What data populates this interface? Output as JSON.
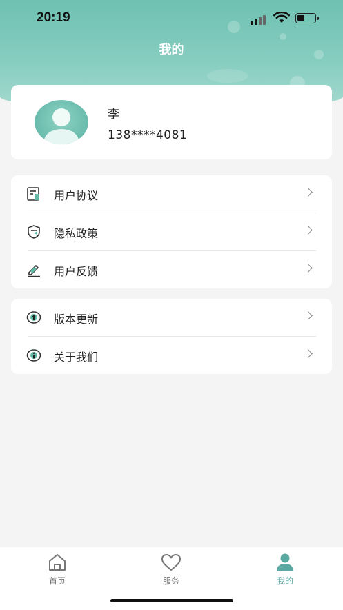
{
  "status": {
    "time": "20:19"
  },
  "header": {
    "title": "我的"
  },
  "profile": {
    "name": "李",
    "phone": "138****4081"
  },
  "menu_group_1": [
    {
      "label": "用户协议",
      "icon": "document-icon"
    },
    {
      "label": "隐私政策",
      "icon": "shield-icon"
    },
    {
      "label": "用户反馈",
      "icon": "edit-icon"
    }
  ],
  "menu_group_2": [
    {
      "label": "版本更新",
      "icon": "update-icon"
    },
    {
      "label": "关于我们",
      "icon": "info-icon"
    }
  ],
  "tabbar": {
    "items": [
      {
        "label": "首页",
        "icon": "home-icon"
      },
      {
        "label": "服务",
        "icon": "heart-icon"
      },
      {
        "label": "我的",
        "icon": "user-icon"
      }
    ],
    "active_color": "#5aa9a0"
  },
  "colors": {
    "accent": "#6fc1b2",
    "icon_green": "#5fb9a5"
  }
}
